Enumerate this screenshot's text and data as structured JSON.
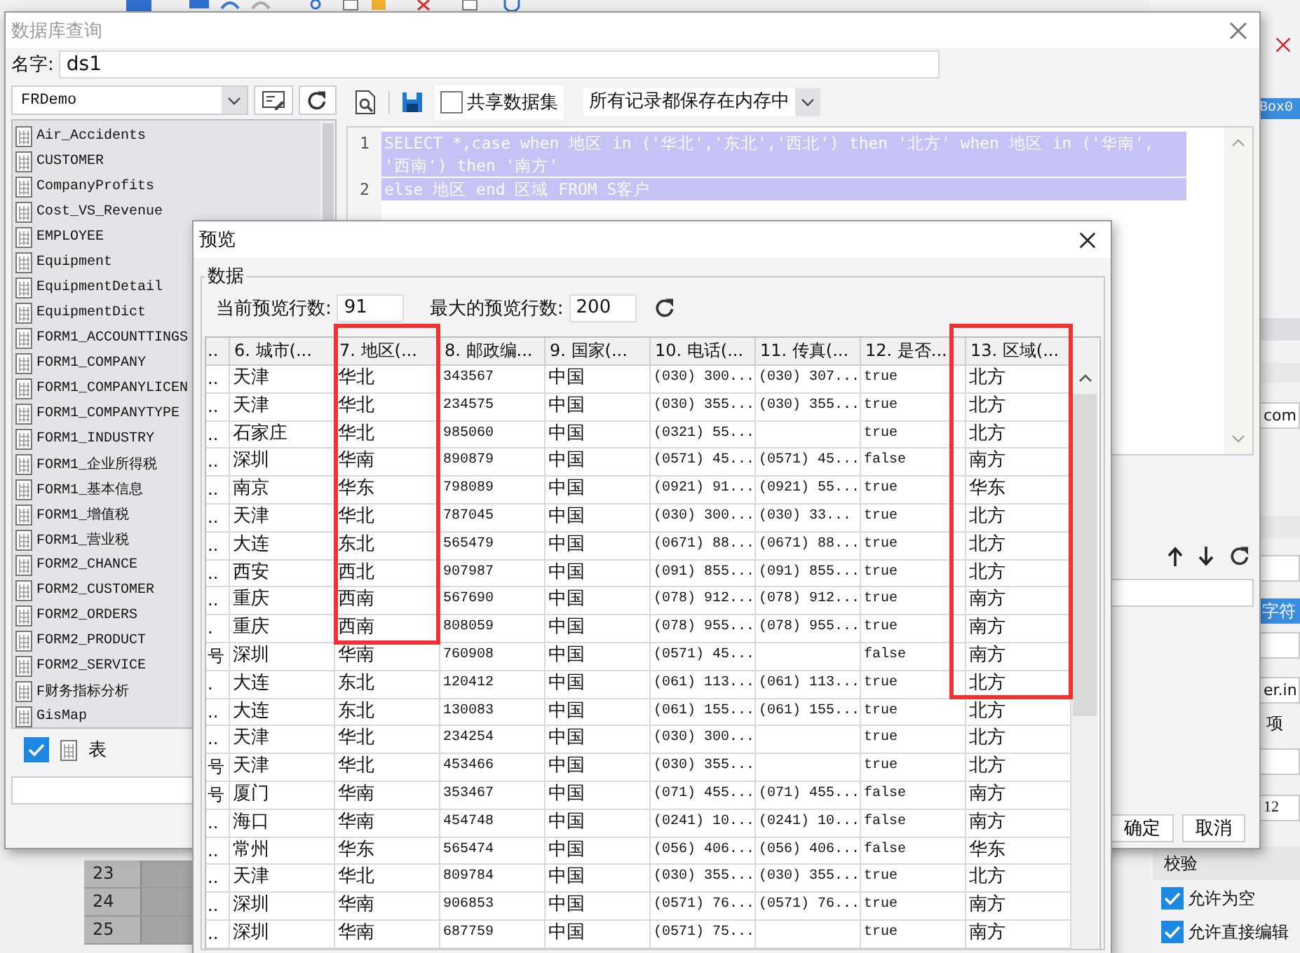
{
  "background": {
    "widget_tag": "Box0",
    "fields": [
      {
        "kind": "bar"
      },
      {
        "kind": "bar"
      },
      {
        "kind": "field",
        "value": "com"
      },
      {
        "kind": "bar"
      },
      {
        "kind": "field"
      },
      {
        "kind": "tag",
        "value": "字符"
      },
      {
        "kind": "field"
      },
      {
        "kind": "field",
        "value": "er.in"
      },
      {
        "kind": "label",
        "value": "项"
      },
      {
        "kind": "field"
      },
      {
        "kind": "field",
        "value": "12"
      }
    ],
    "section": "校验",
    "options": [
      {
        "label": "允许为空",
        "checked": true
      },
      {
        "label": "允许直接编辑",
        "checked": true
      }
    ],
    "row_numbers": [
      "23",
      "24",
      "25"
    ]
  },
  "query_dialog": {
    "title": "数据库查询",
    "name_label": "名字:",
    "name_value": "ds1",
    "connection": "FRDemo",
    "tables": [
      "Air_Accidents",
      "CUSTOMER",
      "CompanyProfits",
      "Cost_VS_Revenue",
      "EMPLOYEE",
      "Equipment",
      "EquipmentDetail",
      "EquipmentDict",
      "FORM1_ACCOUNTTINGS",
      "FORM1_COMPANY",
      "FORM1_COMPANYLICEN",
      "FORM1_COMPANYTYPE",
      "FORM1_INDUSTRY",
      "FORM1_企业所得税",
      "FORM1_基本信息",
      "FORM1_增值税",
      "FORM1_营业税",
      "FORM2_CHANCE",
      "FORM2_CUSTOMER",
      "FORM2_ORDERS",
      "FORM2_PRODUCT",
      "FORM2_SERVICE",
      "F财务指标分析",
      "GisMap"
    ],
    "table_filter": {
      "label": "表",
      "checked": true
    },
    "share_dataset": {
      "label": "共享数据集",
      "checked": false
    },
    "storage_mode": "所有记录都保存在内存中",
    "code_lines": [
      {
        "number": "1",
        "text": "SELECT *,case when 地区 in ('华北','东北','西北') then '北方' when 地区 in ('华南', '西南') then '南方'",
        "selected": true
      },
      {
        "number": "2",
        "text": "else 地区 end 区域 FROM S客户",
        "selected": true
      }
    ],
    "buttons": [
      "确定",
      "取消"
    ]
  },
  "preview_dialog": {
    "title": "预览",
    "group": "数据",
    "current_rows_label": "当前预览行数:",
    "current_rows": "91",
    "max_rows_label": "最大的预览行数:",
    "max_rows": "200",
    "columns": [
      {
        "label": "..",
        "highlighted": false
      },
      {
        "label": "6. 城市(...",
        "highlighted": false
      },
      {
        "label": "7. 地区(...",
        "highlighted": true
      },
      {
        "label": "8. 邮政编...",
        "highlighted": false
      },
      {
        "label": "9. 国家(...",
        "highlighted": false
      },
      {
        "label": "10. 电话(...",
        "highlighted": false
      },
      {
        "label": "11. 传真(...",
        "highlighted": false
      },
      {
        "label": "12. 是否...",
        "highlighted": false
      },
      {
        "label": "13. 区域(...",
        "highlighted": true
      }
    ],
    "rows": [
      [
        "..",
        "天津",
        "华北",
        "343567",
        "中国",
        "(030) 300...",
        "(030) 307...",
        "true",
        "北方"
      ],
      [
        "..",
        "天津",
        "华北",
        "234575",
        "中国",
        "(030) 355...",
        "(030) 355...",
        "true",
        "北方"
      ],
      [
        "..",
        "石家庄",
        "华北",
        "985060",
        "中国",
        "(0321) 55...",
        null,
        "true",
        "北方"
      ],
      [
        "..",
        "深圳",
        "华南",
        "890879",
        "中国",
        "(0571) 45...",
        "(0571) 45...",
        "false",
        "南方"
      ],
      [
        "..",
        "南京",
        "华东",
        "798089",
        "中国",
        "(0921) 91...",
        "(0921) 55...",
        "true",
        "华东"
      ],
      [
        "..",
        "天津",
        "华北",
        "787045",
        "中国",
        "(030) 300...",
        "(030)  33...",
        "true",
        "北方"
      ],
      [
        "..",
        "大连",
        "东北",
        "565479",
        "中国",
        "(0671) 88...",
        "(0671) 88...",
        "true",
        "北方"
      ],
      [
        "..",
        "西安",
        "西北",
        "907987",
        "中国",
        "(091) 855...",
        "(091) 855...",
        "true",
        "北方"
      ],
      [
        "..",
        "重庆",
        "西南",
        "567690",
        "中国",
        "(078) 912...",
        "(078) 912...",
        "true",
        "南方"
      ],
      [
        ".",
        "重庆",
        "西南",
        "808059",
        "中国",
        "(078) 955...",
        "(078) 955...",
        "true",
        "南方"
      ],
      [
        "号",
        "深圳",
        "华南",
        "760908",
        "中国",
        "(0571) 45...",
        null,
        "false",
        "南方"
      ],
      [
        ".",
        "大连",
        "东北",
        "120412",
        "中国",
        "(061) 113...",
        "(061) 113...",
        "true",
        "北方"
      ],
      [
        "..",
        "大连",
        "东北",
        "130083",
        "中国",
        "(061) 155...",
        "(061) 155...",
        "true",
        "北方"
      ],
      [
        "..",
        "天津",
        "华北",
        "234254",
        "中国",
        "(030) 300...",
        null,
        "true",
        "北方"
      ],
      [
        "号",
        "天津",
        "华北",
        "453466",
        "中国",
        "(030) 355...",
        null,
        "true",
        "北方"
      ],
      [
        "号",
        "厦门",
        "华南",
        "353467",
        "中国",
        "(071) 455...",
        "(071) 455...",
        "false",
        "南方"
      ],
      [
        "..",
        "海口",
        "华南",
        "454748",
        "中国",
        "(0241) 10...",
        "(0241) 10...",
        "false",
        "南方"
      ],
      [
        "..",
        "常州",
        "华东",
        "565474",
        "中国",
        "(056) 406...",
        "(056) 406...",
        "false",
        "华东"
      ],
      [
        "..",
        "天津",
        "华北",
        "809784",
        "中国",
        "(030) 355...",
        "(030) 355...",
        "true",
        "北方"
      ],
      [
        "..",
        "深圳",
        "华南",
        "906853",
        "中国",
        "(0571) 76...",
        "(0571) 76...",
        "true",
        "南方"
      ],
      [
        "..",
        "深圳",
        "华南",
        "687759",
        "中国",
        "(0571) 75...",
        null,
        "true",
        "南方"
      ]
    ]
  }
}
